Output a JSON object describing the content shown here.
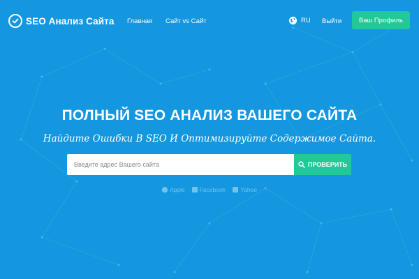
{
  "brand": {
    "name": "SEO Анализ Сайта",
    "icon": "check-circle-icon"
  },
  "nav": {
    "links": [
      "Главная",
      "Сайт vs Сайт"
    ],
    "language": "RU",
    "logout": "Выйти",
    "profile_button": "Ваш Профиль"
  },
  "hero": {
    "title": "ПОЛНЫЙ SEO АНАЛИЗ ВАШЕГО САЙТА",
    "subtitle": "Найдите Ошибки В SEO И Оптимизируйте Содержимое Сайта."
  },
  "search": {
    "placeholder": "Введите адрес Вашего сайта",
    "value": "",
    "button_label": "ПРОВЕРИТЬ"
  },
  "examples": [
    {
      "label": "Apple",
      "icon": "apple-icon"
    },
    {
      "label": "Facebook",
      "icon": "facebook-icon"
    },
    {
      "label": "Yahoo",
      "icon": "yahoo-icon"
    }
  ],
  "colors": {
    "background": "#1597e0",
    "accent": "#20c997",
    "text": "#ffffff",
    "muted_link": "#6fc3ee"
  }
}
